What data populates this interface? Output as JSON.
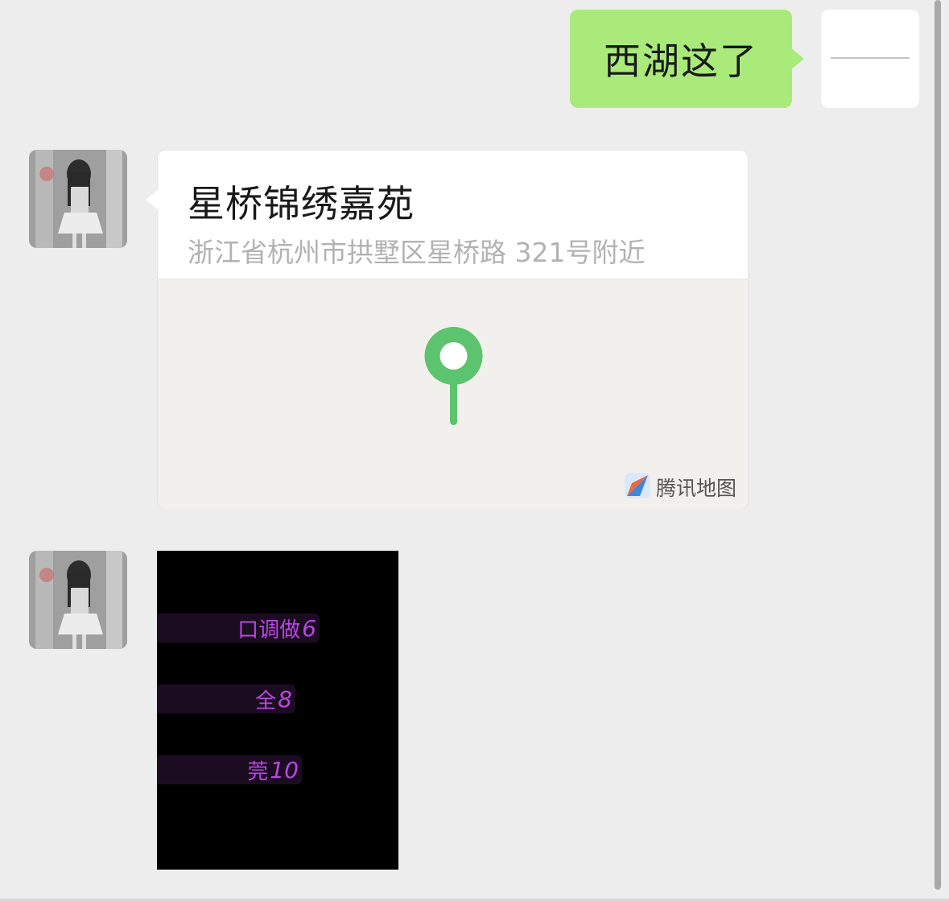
{
  "chat": {
    "sent_message": {
      "text": "西湖这了",
      "bubble_color": "#a9ea7a"
    },
    "location_message": {
      "title": "星桥锦绣嘉苑",
      "address": "浙江省杭州市拱墅区星桥路 321号附近",
      "map_provider": "腾讯地图",
      "pin_color": "#5cc36e",
      "pin_icon": "location-pin-icon",
      "provider_icon": "tencent-map-icon"
    },
    "image_message": {
      "rows": [
        {
          "text": "口调做",
          "num": "6"
        },
        {
          "text": "全",
          "num": "8"
        },
        {
          "text": "莞",
          "num": "10"
        }
      ],
      "text_color": "#b847e0"
    }
  }
}
